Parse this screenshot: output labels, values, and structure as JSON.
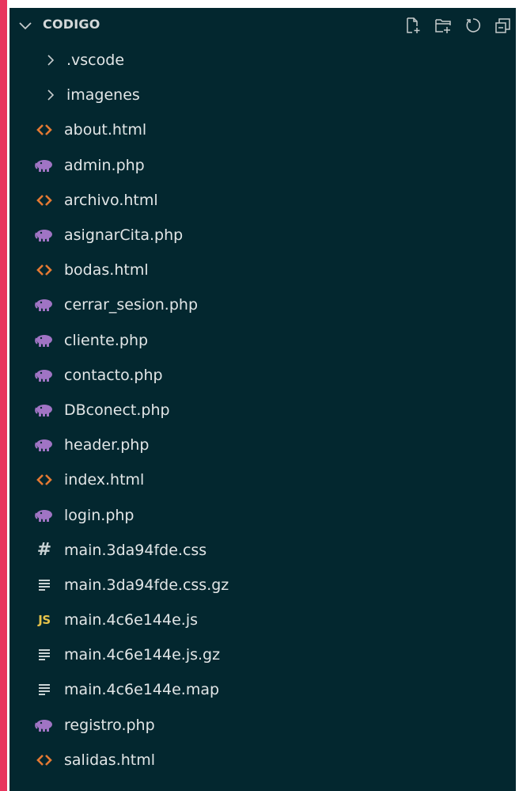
{
  "explorer": {
    "folder_name": "CODIGO",
    "actions": [
      {
        "name": "new-file-icon"
      },
      {
        "name": "new-folder-icon"
      },
      {
        "name": "refresh-icon"
      },
      {
        "name": "collapse-all-icon"
      }
    ],
    "items": [
      {
        "label": ".vscode",
        "kind": "folder"
      },
      {
        "label": "imagenes",
        "kind": "folder"
      },
      {
        "label": "about.html",
        "kind": "html"
      },
      {
        "label": "admin.php",
        "kind": "php"
      },
      {
        "label": "archivo.html",
        "kind": "html"
      },
      {
        "label": "asignarCita.php",
        "kind": "php"
      },
      {
        "label": "bodas.html",
        "kind": "html"
      },
      {
        "label": "cerrar_sesion.php",
        "kind": "php"
      },
      {
        "label": "cliente.php",
        "kind": "php"
      },
      {
        "label": "contacto.php",
        "kind": "php"
      },
      {
        "label": "DBconect.php",
        "kind": "php"
      },
      {
        "label": "header.php",
        "kind": "php"
      },
      {
        "label": "index.html",
        "kind": "html"
      },
      {
        "label": "login.php",
        "kind": "php"
      },
      {
        "label": "main.3da94fde.css",
        "kind": "css"
      },
      {
        "label": "main.3da94fde.css.gz",
        "kind": "text"
      },
      {
        "label": "main.4c6e144e.js",
        "kind": "js"
      },
      {
        "label": "main.4c6e144e.js.gz",
        "kind": "text"
      },
      {
        "label": "main.4c6e144e.map",
        "kind": "text"
      },
      {
        "label": "registro.php",
        "kind": "php"
      },
      {
        "label": "salidas.html",
        "kind": "html"
      }
    ]
  },
  "icon_glyphs": {
    "js": "JS",
    "css": "#"
  },
  "colors": {
    "panel_bg": "#03272f",
    "accent_bar": "#e8355d",
    "html_icon": "#e37933",
    "php_icon": "#a074c4",
    "js_icon": "#e7c34a",
    "text": "#e2e6e7"
  }
}
